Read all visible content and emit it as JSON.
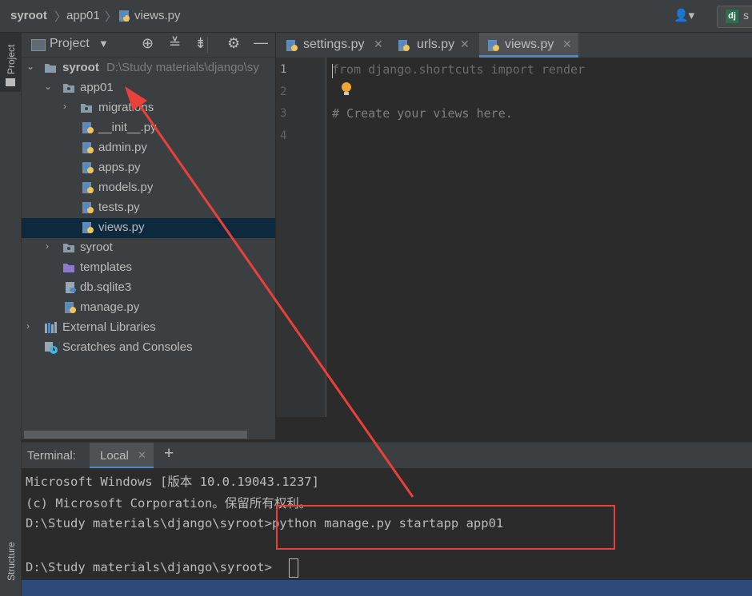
{
  "navbar": {
    "crumbs": [
      "syroot",
      "app01",
      "views.py"
    ],
    "run_config_label": "s"
  },
  "left_stripe": {
    "project_label": "Project",
    "structure_label": "Structure"
  },
  "project_panel": {
    "title": "Project",
    "tree": [
      {
        "label": "syroot",
        "path": "D:\\Study materials\\django\\sy",
        "icon": "folder-icon"
      },
      {
        "label": "app01",
        "icon": "folder-icon"
      },
      {
        "label": "migrations",
        "icon": "folder-icon"
      },
      {
        "label": "__init__.py",
        "icon": "python-file-icon"
      },
      {
        "label": "admin.py",
        "icon": "python-file-icon"
      },
      {
        "label": "apps.py",
        "icon": "python-file-icon"
      },
      {
        "label": "models.py",
        "icon": "python-file-icon"
      },
      {
        "label": "tests.py",
        "icon": "python-file-icon"
      },
      {
        "label": "views.py",
        "icon": "python-file-icon"
      },
      {
        "label": "syroot",
        "icon": "folder-icon"
      },
      {
        "label": "templates",
        "icon": "folder-purple-icon"
      },
      {
        "label": "db.sqlite3",
        "icon": "database-file-icon"
      },
      {
        "label": "manage.py",
        "icon": "python-file-icon"
      },
      {
        "label": "External Libraries",
        "icon": "library-icon"
      },
      {
        "label": "Scratches and Consoles",
        "icon": "scratches-icon"
      }
    ]
  },
  "editor": {
    "tabs": [
      {
        "label": "settings.py"
      },
      {
        "label": "urls.py"
      },
      {
        "label": "views.py",
        "active": true
      }
    ],
    "line_numbers": [
      "1",
      "2",
      "3",
      "4"
    ],
    "lines": {
      "l1_from": "from",
      "l1_module": " django.shortcuts ",
      "l1_import": "import",
      "l1_name": " render",
      "l3_comment": "# Create your views here."
    }
  },
  "terminal": {
    "label": "Terminal:",
    "tab": "Local",
    "add": "+",
    "lines": [
      "Microsoft Windows [版本 10.0.19043.1237]",
      "(c) Microsoft Corporation。保留所有权利。",
      "D:\\Study materials\\django\\syroot>python manage.py startapp app01",
      "",
      "D:\\Study materials\\django\\syroot>"
    ]
  },
  "colors": {
    "annotation_red": "#e8413a",
    "selection": "#0d293e",
    "accent": "#4a88c7"
  }
}
